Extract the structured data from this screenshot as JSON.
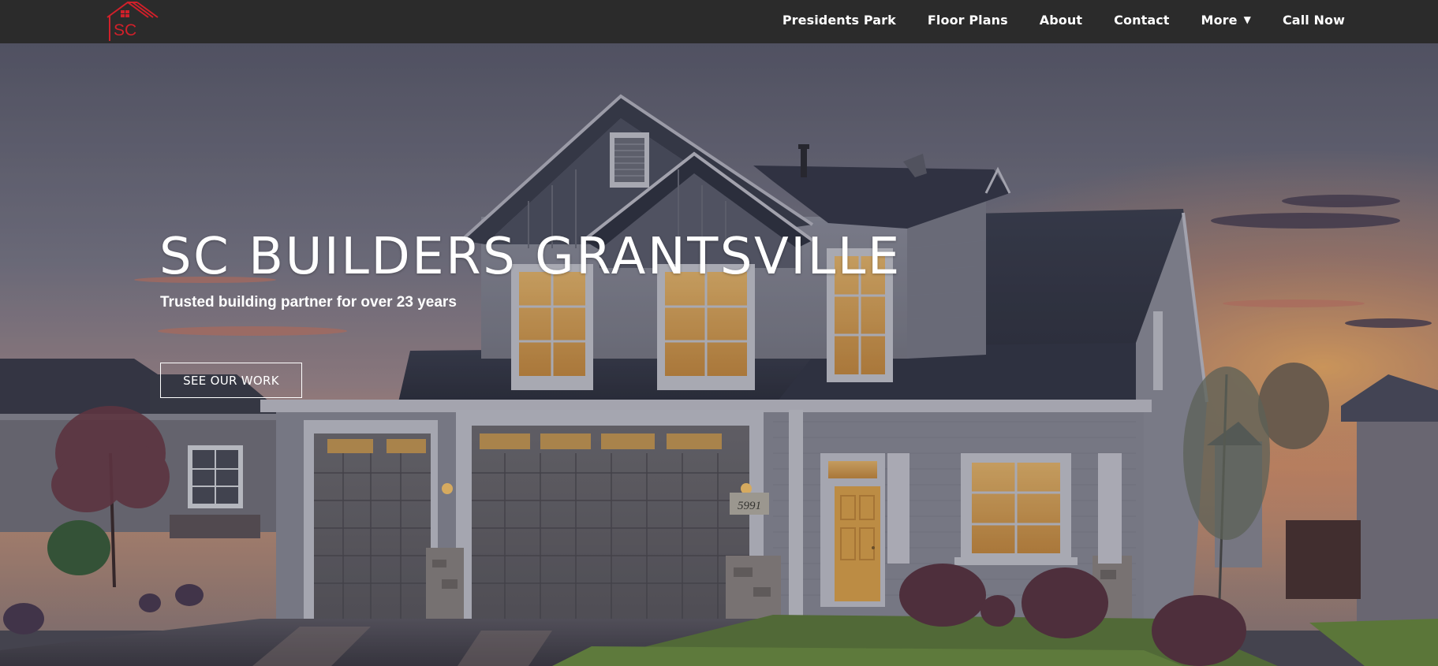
{
  "brand": {
    "logo_text": "SC",
    "logo_color": "#d0202a"
  },
  "nav": {
    "items": [
      {
        "label": "Presidents Park"
      },
      {
        "label": "Floor Plans"
      },
      {
        "label": "About"
      },
      {
        "label": "Contact"
      },
      {
        "label": "More",
        "caret": "▼"
      },
      {
        "label": "Call Now"
      }
    ]
  },
  "hero": {
    "title": "SC BUILDERS GRANTSVILLE",
    "subtitle": "Trusted building partner for over 23 years",
    "cta_label": "SEE OUR WORK",
    "house_number": "5991"
  },
  "colors": {
    "navbar_bg": "#2b2b2b",
    "text": "#ffffff",
    "accent": "#d0202a"
  }
}
